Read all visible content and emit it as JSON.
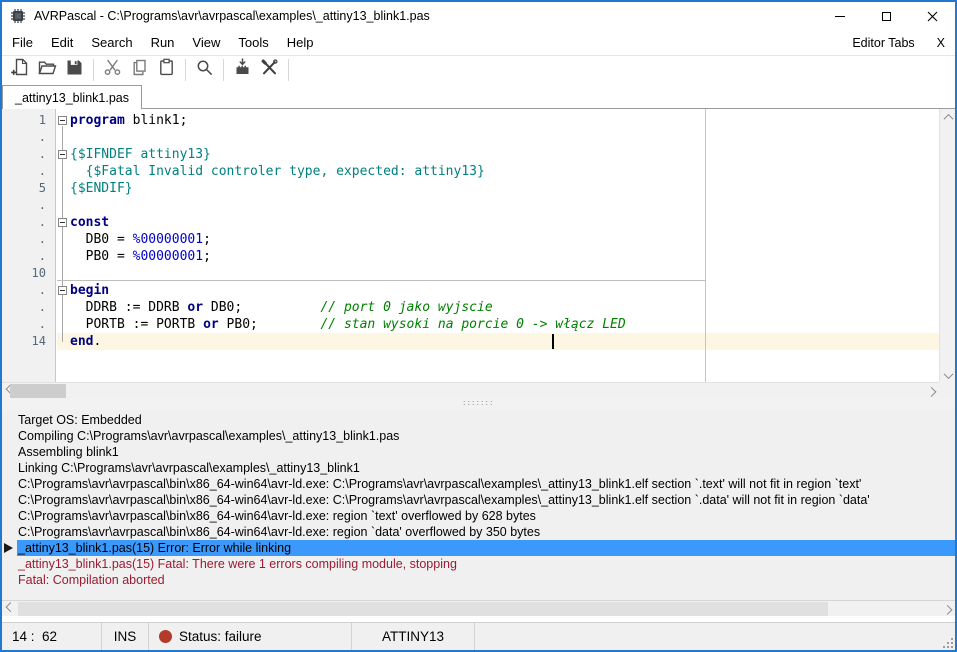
{
  "titlebar": {
    "title": "AVRPascal - C:\\Programs\\avr\\avrpascal\\examples\\_attiny13_blink1.pas",
    "app_icon": "chip-icon",
    "window_controls": [
      "minimize",
      "maximize",
      "close"
    ]
  },
  "menu": {
    "items": [
      "File",
      "Edit",
      "Search",
      "Run",
      "View",
      "Tools",
      "Help"
    ],
    "right_items": [
      "Editor Tabs",
      "X"
    ]
  },
  "toolbar": {
    "items": [
      {
        "icon": "new-file"
      },
      {
        "icon": "open-folder"
      },
      {
        "icon": "save"
      },
      {
        "icon": "separator"
      },
      {
        "icon": "cut"
      },
      {
        "icon": "copy"
      },
      {
        "icon": "paste"
      },
      {
        "icon": "separator"
      },
      {
        "icon": "search"
      },
      {
        "icon": "separator"
      },
      {
        "icon": "flash-chip"
      },
      {
        "icon": "tools"
      },
      {
        "icon": "separator"
      }
    ]
  },
  "tabs": [
    {
      "label": "_attiny13_blink1.pas",
      "active": true
    }
  ],
  "editor": {
    "current_line": 14,
    "caret": {
      "line": 14,
      "col": 62
    },
    "lines": [
      {
        "num": "1",
        "fold": true,
        "tokens": [
          [
            "kw",
            "program"
          ],
          [
            "pl",
            " blink1;"
          ]
        ]
      },
      {
        "num": ".",
        "fold": false,
        "tokens": []
      },
      {
        "num": ".",
        "fold": true,
        "tokens": [
          [
            "dir",
            "{$IFNDEF attiny13}"
          ]
        ]
      },
      {
        "num": ".",
        "fold": false,
        "tokens": [
          [
            "dir",
            "  {$Fatal Invalid controler type, expected: attiny13}"
          ]
        ]
      },
      {
        "num": "5",
        "fold": false,
        "tokens": [
          [
            "dir",
            "{$ENDIF}"
          ]
        ]
      },
      {
        "num": ".",
        "fold": false,
        "tokens": []
      },
      {
        "num": ".",
        "fold": true,
        "tokens": [
          [
            "kw",
            "const"
          ]
        ]
      },
      {
        "num": ".",
        "fold": false,
        "tokens": [
          [
            "pl",
            "  DB0 = "
          ],
          [
            "num",
            "%00000001"
          ],
          [
            "pl",
            ";"
          ]
        ]
      },
      {
        "num": ".",
        "fold": false,
        "tokens": [
          [
            "pl",
            "  PB0 = "
          ],
          [
            "num",
            "%00000001"
          ],
          [
            "pl",
            ";"
          ]
        ]
      },
      {
        "num": "10",
        "fold": false,
        "tokens": []
      },
      {
        "num": ".",
        "fold": true,
        "tokens": [
          [
            "kw",
            "begin"
          ]
        ]
      },
      {
        "num": ".",
        "fold": false,
        "tokens": [
          [
            "pl",
            "  DDRB := DDRB "
          ],
          [
            "kw",
            "or"
          ],
          [
            "pl",
            " DB0;          "
          ],
          [
            "cm",
            "// port 0 jako wyjscie"
          ]
        ]
      },
      {
        "num": ".",
        "fold": false,
        "tokens": [
          [
            "pl",
            "  PORTB := PORTB "
          ],
          [
            "kw",
            "or"
          ],
          [
            "pl",
            " PB0;        "
          ],
          [
            "cm",
            "// stan wysoki na porcie 0 -> włącz LED"
          ]
        ]
      },
      {
        "num": "14",
        "fold": false,
        "tokens": [
          [
            "kw",
            "end"
          ],
          [
            "pl",
            "."
          ]
        ]
      }
    ]
  },
  "messages": {
    "rows": [
      {
        "text": "Target OS: Embedded",
        "style": "normal"
      },
      {
        "text": "Compiling C:\\Programs\\avr\\avrpascal\\examples\\_attiny13_blink1.pas",
        "style": "normal"
      },
      {
        "text": "Assembling blink1",
        "style": "normal"
      },
      {
        "text": "Linking C:\\Programs\\avr\\avrpascal\\examples\\_attiny13_blink1",
        "style": "normal"
      },
      {
        "text": "C:\\Programs\\avr\\avrpascal\\bin\\x86_64-win64\\avr-ld.exe: C:\\Programs\\avr\\avrpascal\\examples\\_attiny13_blink1.elf section `.text' will not fit in region `text'",
        "style": "normal"
      },
      {
        "text": "C:\\Programs\\avr\\avrpascal\\bin\\x86_64-win64\\avr-ld.exe: C:\\Programs\\avr\\avrpascal\\examples\\_attiny13_blink1.elf section `.data' will not fit in region `data'",
        "style": "normal"
      },
      {
        "text": "C:\\Programs\\avr\\avrpascal\\bin\\x86_64-win64\\avr-ld.exe: region `text' overflowed by 628 bytes",
        "style": "normal"
      },
      {
        "text": "C:\\Programs\\avr\\avrpascal\\bin\\x86_64-win64\\avr-ld.exe: region `data' overflowed by 350 bytes",
        "style": "normal"
      },
      {
        "text": "_attiny13_blink1.pas(15) Error: Error while linking",
        "style": "selected"
      },
      {
        "text": "_attiny13_blink1.pas(15) Fatal: There were 1 errors compiling module, stopping",
        "style": "error"
      },
      {
        "text": "Fatal: Compilation aborted",
        "style": "error"
      }
    ]
  },
  "statusbar": {
    "caret_pos": "14 :  62",
    "insert_mode": "INS",
    "status_text": "Status: failure",
    "device": "ATTINY13"
  },
  "colors": {
    "window_border": "#2277cf",
    "selection_blue": "#3b99fc",
    "error_red": "#9b1b30",
    "status_dot": "#b33b2b",
    "keyword": "#000080",
    "directive": "#008080",
    "number": "#0000cc",
    "comment": "#008000",
    "current_line_bg": "#fcf6e3"
  }
}
